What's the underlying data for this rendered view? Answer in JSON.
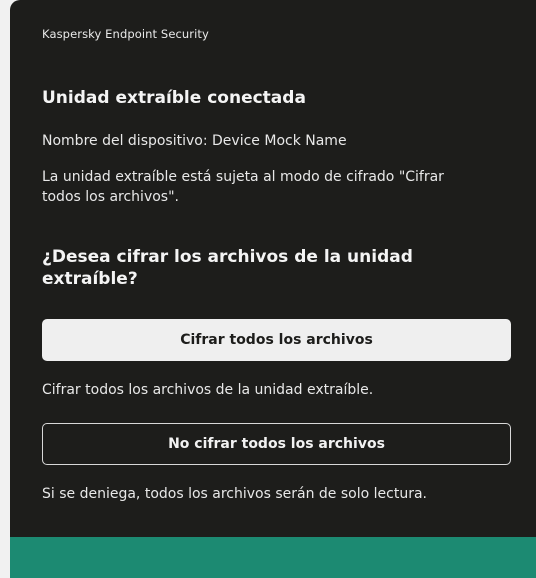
{
  "window": {
    "app_title": "Kaspersky Endpoint Security"
  },
  "dialog": {
    "heading": "Unidad extraíble conectada",
    "device_label": "Nombre del dispositivo:",
    "device_name": "Device Mock Name",
    "mode_text": "La unidad extraíble está sujeta al modo de cifrado \"Cifrar todos los archivos\".",
    "question": "¿Desea cifrar los archivos de la unidad extraíble?"
  },
  "actions": {
    "encrypt_label": "Cifrar todos los archivos",
    "encrypt_description": "Cifrar todos los archivos de la unidad extraíble.",
    "skip_label": "No cifrar todos los archivos",
    "skip_description": "Si se deniega, todos los archivos serán de solo lectura."
  },
  "colors": {
    "background": "#1d1d1b",
    "footer_accent": "#1c8a72",
    "primary_button": "#efefef"
  }
}
